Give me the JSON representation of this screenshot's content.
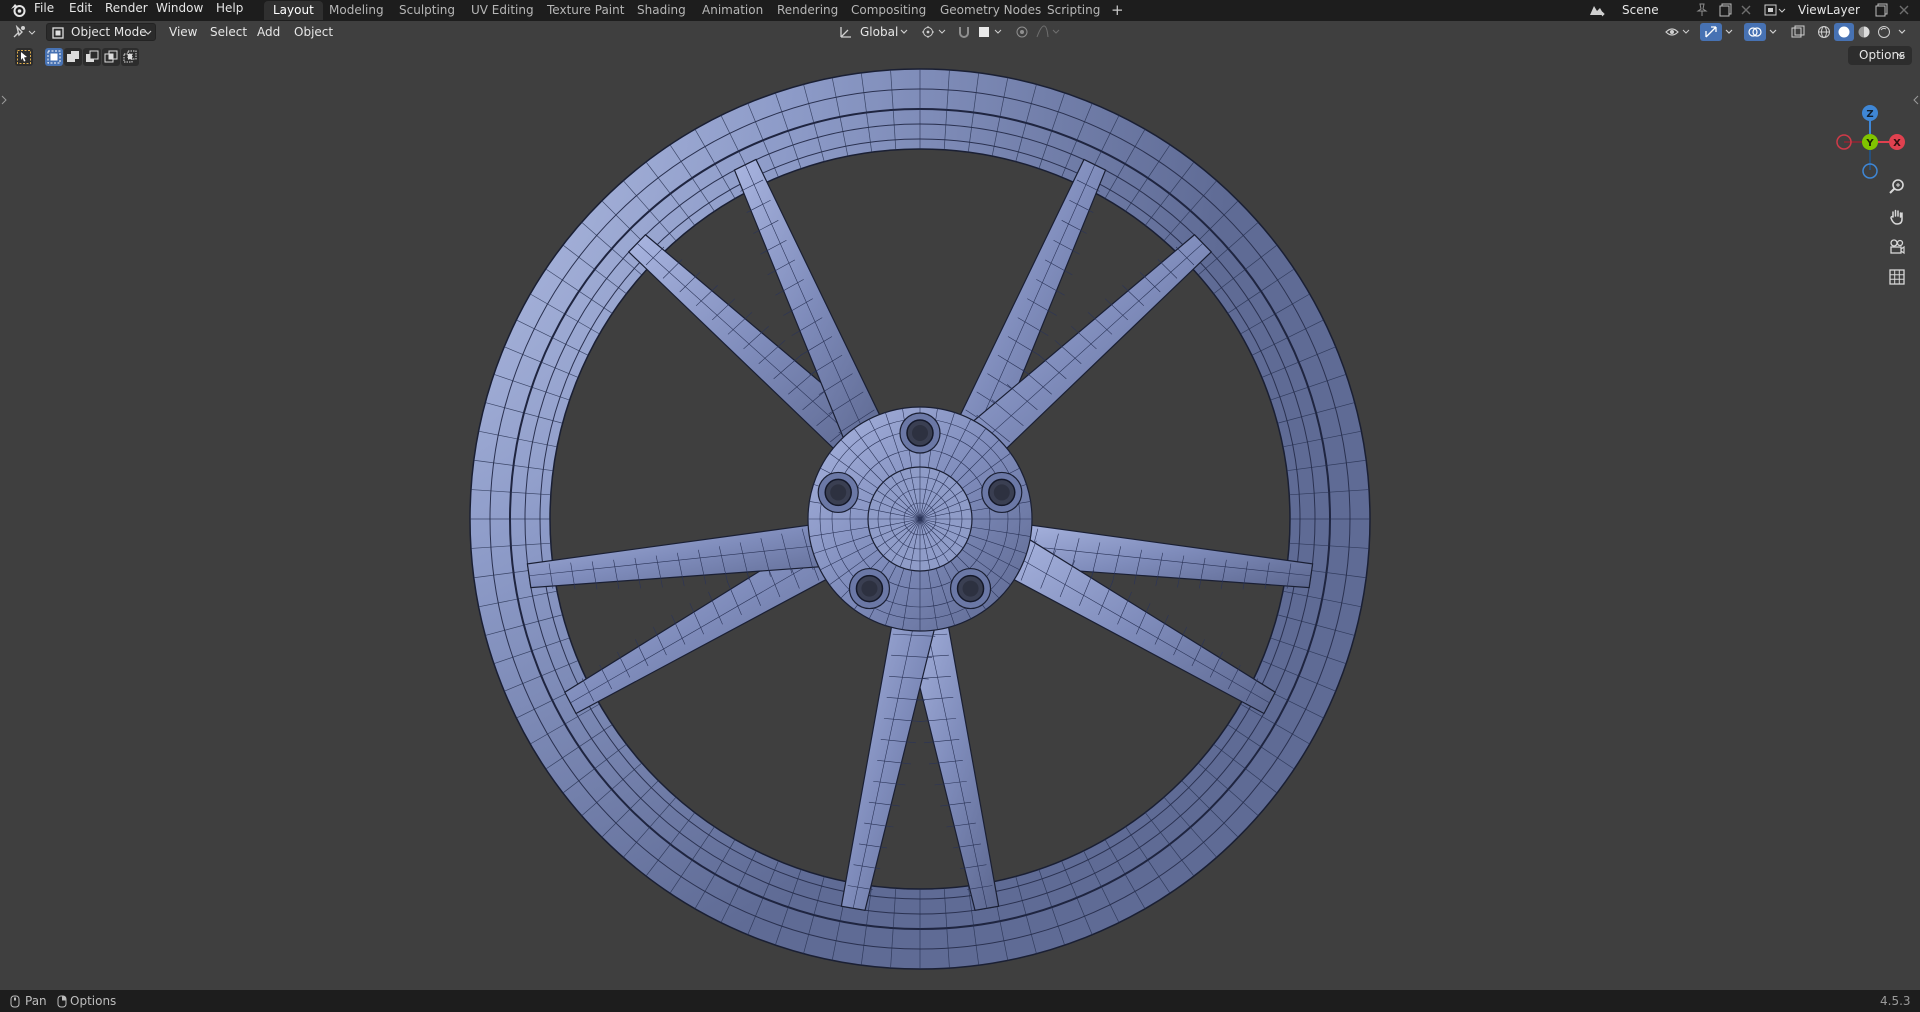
{
  "menubar": {
    "items": [
      "File",
      "Edit",
      "Render",
      "Window",
      "Help"
    ]
  },
  "workspaces": {
    "tabs": [
      "Layout",
      "Modeling",
      "Sculpting",
      "UV Editing",
      "Texture Paint",
      "Shading",
      "Animation",
      "Rendering",
      "Compositing",
      "Geometry Nodes",
      "Scripting"
    ],
    "active": "Layout",
    "add_label": "+"
  },
  "scene": {
    "label": "Scene"
  },
  "view_layer": {
    "label": "ViewLayer"
  },
  "viewport_header": {
    "mode": "Object Mode",
    "menus": [
      "View",
      "Select",
      "Add",
      "Object"
    ],
    "transform_orientation": "Global"
  },
  "viewport": {
    "options_label": "Options",
    "background_color": "#3f3f3f",
    "mesh_color": "#9aa8d8",
    "gizmo": {
      "z_label": "Z",
      "y_label": "Y",
      "x_label": "X"
    }
  },
  "statusbar": {
    "left_items": [
      "Pan",
      "Options"
    ],
    "version": "4.5.3"
  },
  "colors": {
    "accent": "#4772b3",
    "axis_x": "#e0414f",
    "axis_y": "#80c400",
    "axis_z": "#3f87d6"
  }
}
